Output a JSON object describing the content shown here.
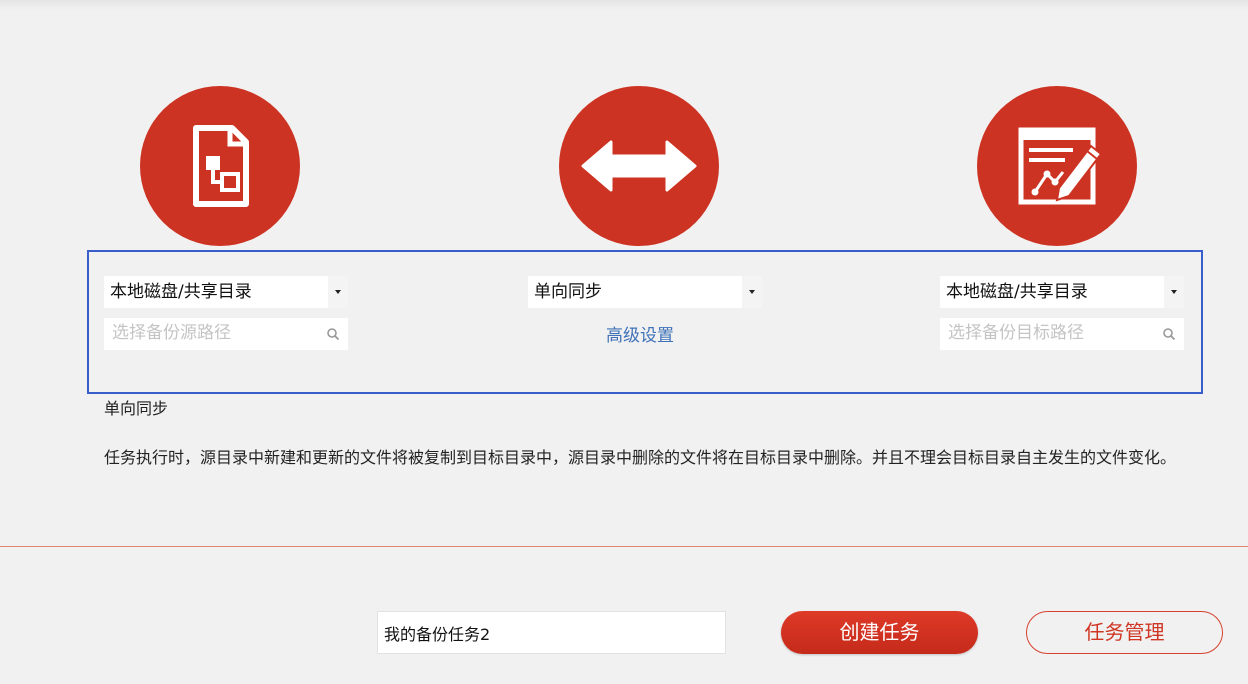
{
  "source": {
    "type_select": "本地磁盘/共享目录",
    "path_placeholder": "选择备份源路径"
  },
  "sync": {
    "mode_select": "单向同步",
    "advanced_link": "高级设置"
  },
  "target": {
    "type_select": "本地磁盘/共享目录",
    "path_placeholder": "选择备份目标路径"
  },
  "description": {
    "title": "单向同步",
    "text": "任务执行时，源目录中新建和更新的文件将被复制到目标目录中，源目录中删除的文件将在目标目录中删除。并且不理会目标目录自主发生的文件变化。"
  },
  "footer": {
    "task_name_value": "我的备份任务2",
    "create_button": "创建任务",
    "manage_button": "任务管理"
  },
  "colors": {
    "accent_red": "#cd3322",
    "config_border_blue": "#3a5dcc",
    "link_blue": "#3f72b8"
  },
  "icons": {
    "source": "file-document-icon",
    "mode": "double-arrow-icon",
    "target": "edit-document-icon"
  }
}
